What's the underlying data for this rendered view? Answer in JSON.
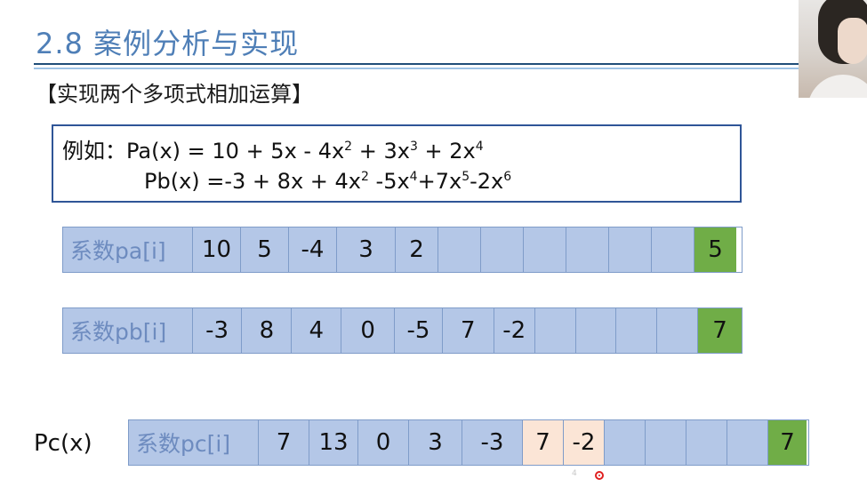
{
  "slide": {
    "title": "2.8 案例分析与实现",
    "subtitle": "【实现两个多项式相加运算】"
  },
  "formula": {
    "prefix": "例如：",
    "pa": {
      "lhs": "Pa(x) = 10 + 5x - 4x",
      "e1": "2",
      "t2": " + 3x",
      "e2": "3",
      "t3": " + 2x",
      "e3": "4"
    },
    "pb": {
      "lhs": "Pb(x) =-3 + 8x + 4x",
      "e1": "2",
      "t2": " -5x",
      "e2": "4",
      "t3": "+7x",
      "e3": "5",
      "t4": "-2x",
      "e4": "6"
    }
  },
  "arrays": {
    "pa": {
      "label": "系数pa[i]",
      "cells": [
        "10",
        "5",
        "-4",
        "3",
        "2",
        "",
        "",
        "",
        "",
        "",
        "",
        ""
      ],
      "count": "5"
    },
    "pb": {
      "label": "系数pb[i]",
      "cells": [
        "-3",
        "8",
        "4",
        "0",
        "-5",
        "7",
        "-2",
        "",
        "",
        "",
        "",
        ""
      ],
      "count": "7"
    },
    "pc": {
      "outside_label": "Pc(x)",
      "label": "系数pc[i]",
      "cells": [
        "7",
        "13",
        "0",
        "3",
        "-3",
        "7",
        "-2",
        "",
        "",
        "",
        "",
        ""
      ],
      "count": "7"
    }
  },
  "annotations": {
    "small_mark": "4"
  }
}
